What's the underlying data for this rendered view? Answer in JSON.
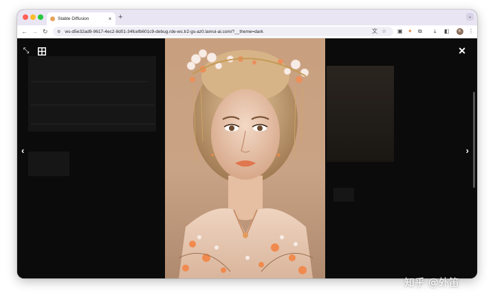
{
  "browser": {
    "tab": {
      "title": "Stable Diffusion",
      "close_icon": "×"
    },
    "new_tab_icon": "+",
    "tab_menu_icon": "⌄",
    "nav": {
      "back": "←",
      "forward": "→",
      "reload": "↻"
    },
    "omnibox": {
      "url": "ws-d5e32ad9-9617-4ec2-8d01-34fcefb601c9-debug.rde-ws.tr2-gs-az0.lanrui-ai.com/?__theme=dark",
      "site_info_icon": "⚙",
      "translate_icon": "文",
      "star_icon": "☆"
    },
    "extensions": {
      "ext1": "▣",
      "ext2": "✦",
      "ext3": "⧉"
    },
    "download_icon": "⤓",
    "side_panel_icon": "◧",
    "profile_initial": "K",
    "menu_icon": "⋮"
  },
  "viewer": {
    "fullscreen_icon": "⤡",
    "close_icon": "✕",
    "prev_icon": "‹",
    "next_icon": "›"
  },
  "watermark": "知乎 @外笛",
  "colors": {
    "tab_strip": "#e9e5f3",
    "viewer_bg": "#0b0b0b",
    "photo_bg": "#c8a07f"
  }
}
